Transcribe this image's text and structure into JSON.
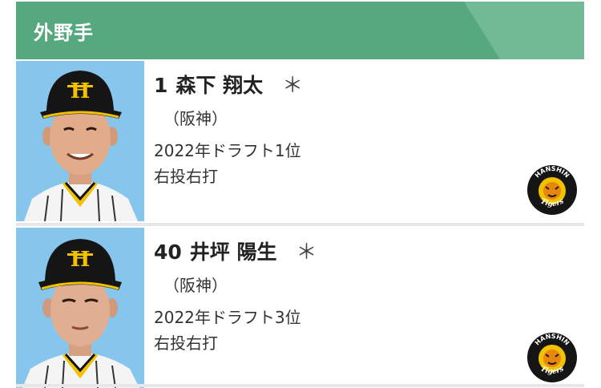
{
  "header": {
    "title": "外野手"
  },
  "players": [
    {
      "number": "1",
      "name": "森下 翔太",
      "mark": "＊",
      "team": "（阪神）",
      "draft": "2022年ドラフト1位",
      "bats": "右投右打"
    },
    {
      "number": "40",
      "name": "井坪 陽生",
      "mark": "＊",
      "team": "（阪神）",
      "draft": "2022年ドラフト3位",
      "bats": "右投右打"
    }
  ],
  "logo": {
    "top_text": "HANSHIN",
    "bottom_text": "Tigers"
  },
  "colors": {
    "header_green": "#56a97f",
    "photo_background": "#86c5ec",
    "cap_black": "#151515",
    "tigers_yellow": "#f2c200"
  }
}
